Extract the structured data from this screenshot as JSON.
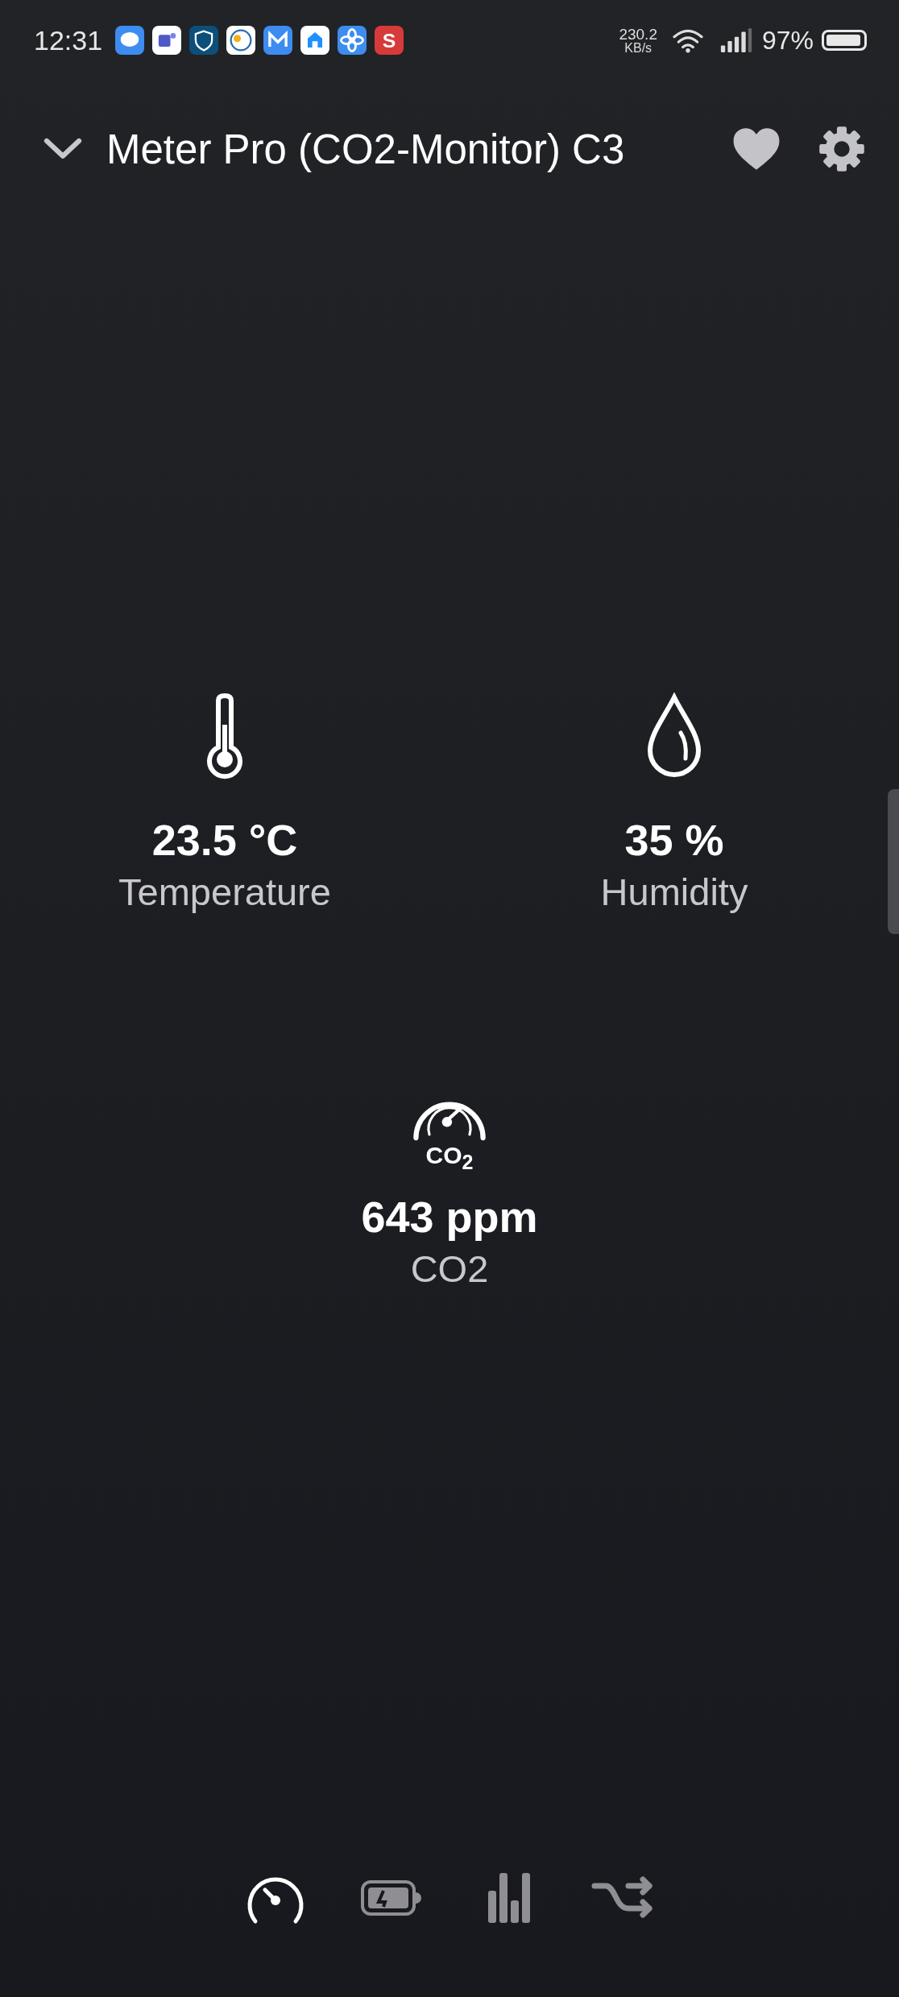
{
  "status_bar": {
    "time": "12:31",
    "apps": [
      {
        "kind": "chat",
        "color": "#3d8cf0"
      },
      {
        "kind": "teams",
        "color": "#ffffff"
      },
      {
        "kind": "shield",
        "color": "#0d4f7a"
      },
      {
        "kind": "weather",
        "color": "#ffffff"
      },
      {
        "kind": "mail",
        "color": "#3d8cf0"
      },
      {
        "kind": "home",
        "color": "#ffffff"
      },
      {
        "kind": "fan",
        "color": "#3d8cf0"
      },
      {
        "kind": "letter",
        "color": "#d63a3a",
        "glyph": "S"
      }
    ],
    "speed": "230.2",
    "speed_unit": "KB/s",
    "battery": "97%"
  },
  "header": {
    "title": "Meter Pro (CO2-Monitor) C3"
  },
  "sensors": [
    {
      "kind": "temperature",
      "value": "23.5 °C",
      "label": "Temperature"
    },
    {
      "kind": "humidity",
      "value": "35 %",
      "label": "Humidity"
    },
    {
      "kind": "co2",
      "icon_label": "CO$_{2}$",
      "value": "643 ppm",
      "label": "CO2"
    }
  ],
  "nav": [
    {
      "kind": "gauge",
      "selected": true
    },
    {
      "kind": "battery",
      "selected": false
    },
    {
      "kind": "bars",
      "selected": false
    },
    {
      "kind": "shuffle",
      "selected": false
    }
  ]
}
